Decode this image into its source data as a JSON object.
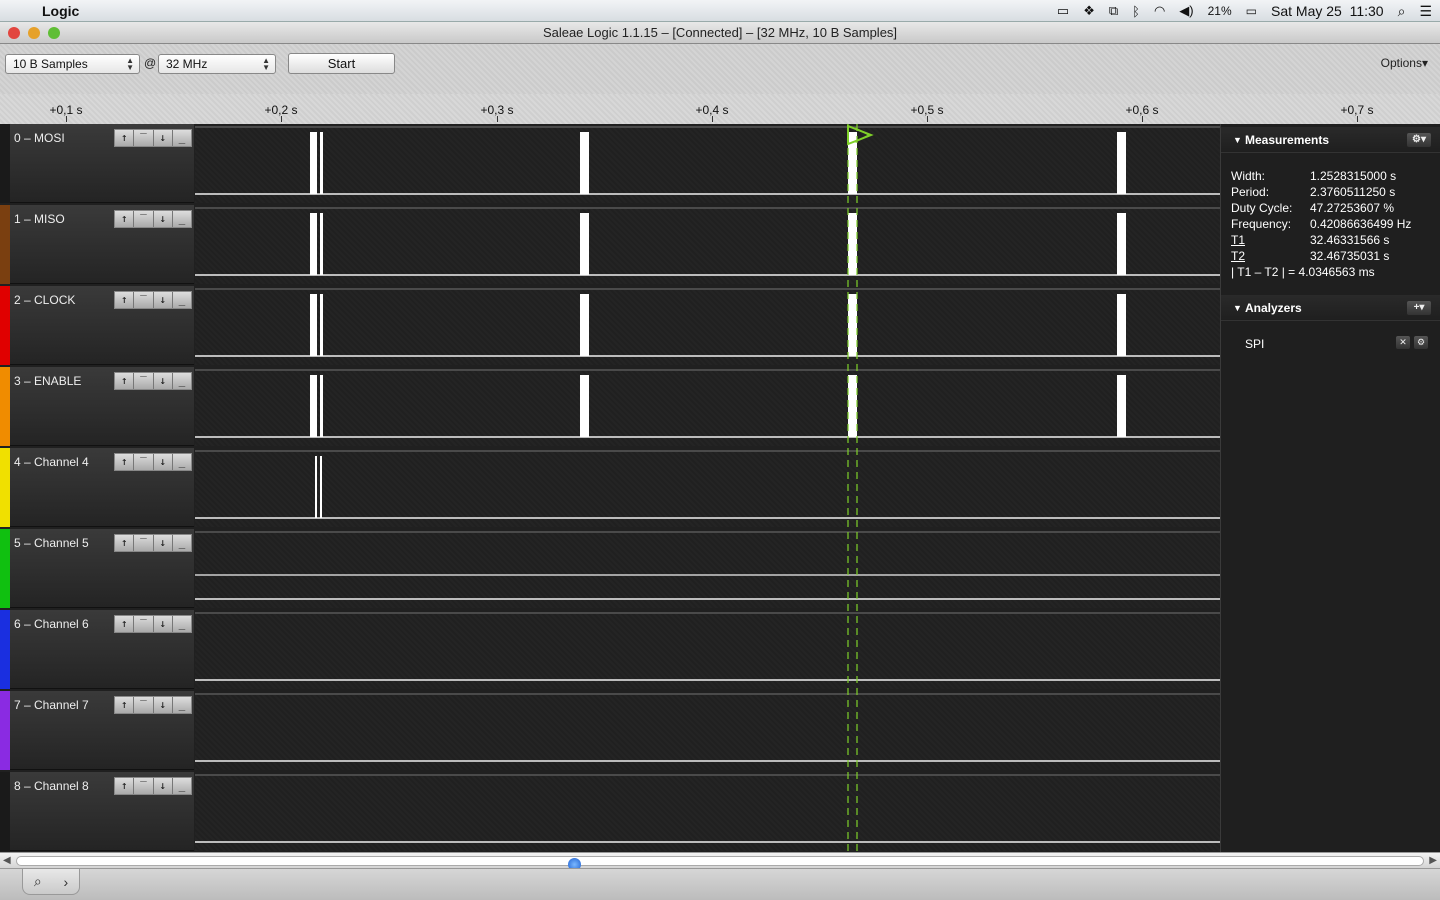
{
  "menubar": {
    "app_name": "Logic",
    "status_icons": [
      "airplay-icon",
      "dropbox-icon",
      "sync-icon",
      "bluetooth-icon",
      "wifi-icon",
      "volume-icon"
    ],
    "battery": "21%",
    "datetime": "Sat May 25  11:30"
  },
  "window": {
    "title": "Saleae Logic 1.1.15 – [Connected] – [32 MHz, 10 B Samples]"
  },
  "toolbar": {
    "samples_value": "10 B Samples",
    "at_label": "@",
    "rate_value": "32 MHz",
    "start_label": "Start",
    "options_label": "Options▾"
  },
  "ruler": {
    "ticks": [
      "+0,1 s",
      "+0,2 s",
      "+0,3 s",
      "+0,4 s",
      "+0,5 s",
      "+0,6 s",
      "+0,7 s"
    ]
  },
  "channels": [
    {
      "name": "0 – MOSI",
      "color": "#1a1a1a"
    },
    {
      "name": "1 – MISO",
      "color": "#7a3f10"
    },
    {
      "name": "2 – CLOCK",
      "color": "#e00000"
    },
    {
      "name": "3 – ENABLE",
      "color": "#f08c00"
    },
    {
      "name": "4 – Channel 4",
      "color": "#f0e000"
    },
    {
      "name": "5 – Channel 5",
      "color": "#10c010"
    },
    {
      "name": "6 – Channel 6",
      "color": "#1a2fe0"
    },
    {
      "name": "7 – Channel 7",
      "color": "#8a2be2"
    },
    {
      "name": "8 – Channel 8",
      "color": "#1a1a1a"
    }
  ],
  "trigger_buttons": [
    "rising-edge",
    "high",
    "falling-edge",
    "low"
  ],
  "measurements": {
    "title": "Measurements",
    "rows": [
      {
        "label": "Width:",
        "value": "1.2528315000 s"
      },
      {
        "label": "Period:",
        "value": "2.3760511250 s"
      },
      {
        "label": "Duty Cycle:",
        "value": "47.27253607 %"
      },
      {
        "label": "Frequency:",
        "value": "0.42086636499 Hz"
      },
      {
        "label": "T1",
        "value": "32.46331566 s"
      },
      {
        "label": "T2",
        "value": "32.46735031 s"
      },
      {
        "label": "| T1 – T2 | =",
        "value": "4.0346563 ms"
      }
    ]
  },
  "analyzers": {
    "title": "Analyzers",
    "items": [
      {
        "name": "SPI"
      }
    ]
  }
}
